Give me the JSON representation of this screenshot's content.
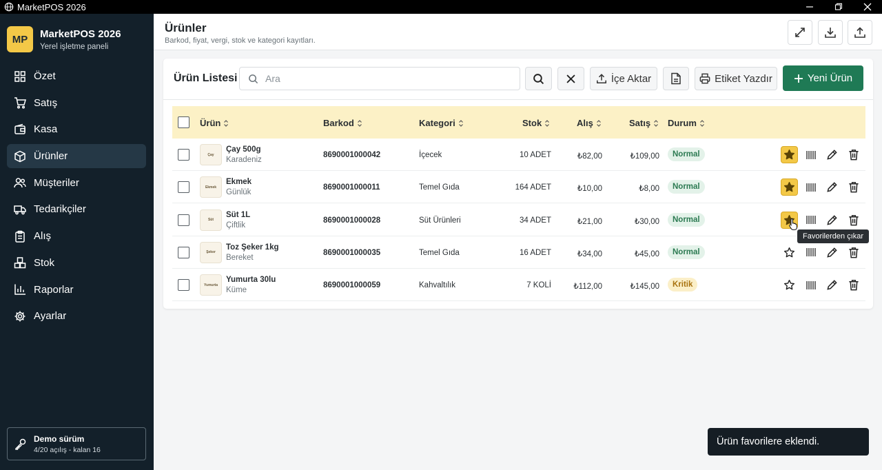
{
  "window": {
    "title": "MarketPOS 2026",
    "icon": "globe-icon"
  },
  "sidebar": {
    "brand": {
      "logo": "MP",
      "name": "MarketPOS 2026",
      "subtitle": "Yerel işletme paneli"
    },
    "items": [
      {
        "label": "Özet",
        "icon": "dashboard-icon",
        "active": false
      },
      {
        "label": "Satış",
        "icon": "cart-icon",
        "active": false
      },
      {
        "label": "Kasa",
        "icon": "cash-register-icon",
        "active": false
      },
      {
        "label": "Ürünler",
        "icon": "box-icon",
        "active": true
      },
      {
        "label": "Müşteriler",
        "icon": "users-icon",
        "active": false
      },
      {
        "label": "Tedarikçiler",
        "icon": "truck-icon",
        "active": false
      },
      {
        "label": "Alış",
        "icon": "clipboard-icon",
        "active": false
      },
      {
        "label": "Stok",
        "icon": "boxes-icon",
        "active": false
      },
      {
        "label": "Raporlar",
        "icon": "bar-chart-icon",
        "active": false
      },
      {
        "label": "Ayarlar",
        "icon": "gear-icon",
        "active": false
      }
    ],
    "license": {
      "title": "Demo sürüm",
      "detail": "4/20 açılış - kalan 16",
      "icon": "key-icon"
    }
  },
  "header": {
    "title": "Ürünler",
    "subtitle": "Barkod, fiyat, vergi, stok ve kategori kayıtları.",
    "buttons": [
      "fullscreen-icon",
      "download-icon",
      "upload-icon"
    ]
  },
  "toolbar": {
    "list_title": "Ürün Listesi",
    "search_placeholder": "Ara",
    "search_value": "",
    "import_label": "İçe Aktar",
    "print_label": "Etiket Yazdır",
    "new_label": "Yeni Ürün"
  },
  "table": {
    "columns": {
      "product": "Ürün",
      "barcode": "Barkod",
      "category": "Kategori",
      "stock": "Stok",
      "buy": "Alış",
      "sell": "Satış",
      "status": "Durum"
    },
    "rows": [
      {
        "thumb": "Çay",
        "name": "Çay 500g",
        "brand": "Karadeniz",
        "barcode": "8690001000042",
        "category": "İçecek",
        "stock": "10 ADET",
        "buy": "₺82,00",
        "sell": "₺109,00",
        "status": "Normal",
        "favorite": true
      },
      {
        "thumb": "Ekmek",
        "name": "Ekmek",
        "brand": "Günlük",
        "barcode": "8690001000011",
        "category": "Temel Gıda",
        "stock": "164 ADET",
        "buy": "₺10,00",
        "sell": "₺8,00",
        "status": "Normal",
        "favorite": true
      },
      {
        "thumb": "Süt",
        "name": "Süt 1L",
        "brand": "Çiftlik",
        "barcode": "8690001000028",
        "category": "Süt Ürünleri",
        "stock": "34 ADET",
        "buy": "₺21,00",
        "sell": "₺30,00",
        "status": "Normal",
        "favorite": true
      },
      {
        "thumb": "Şeker",
        "name": "Toz Şeker 1kg",
        "brand": "Bereket",
        "barcode": "8690001000035",
        "category": "Temel Gıda",
        "stock": "16 ADET",
        "buy": "₺34,00",
        "sell": "₺45,00",
        "status": "Normal",
        "favorite": false
      },
      {
        "thumb": "Yumurta",
        "name": "Yumurta 30lu",
        "brand": "Küme",
        "barcode": "8690001000059",
        "category": "Kahvaltılık",
        "stock": "7 KOLİ",
        "buy": "₺112,00",
        "sell": "₺145,00",
        "status": "Kritik",
        "favorite": false
      }
    ]
  },
  "tooltip": "Favorilerden çıkar",
  "toast": "Ürün favorilere eklendi.",
  "colors": {
    "sidebar": "#13202a",
    "accent": "#1f7a55",
    "star": "#f3c847",
    "header_row": "#fcf1c6"
  }
}
